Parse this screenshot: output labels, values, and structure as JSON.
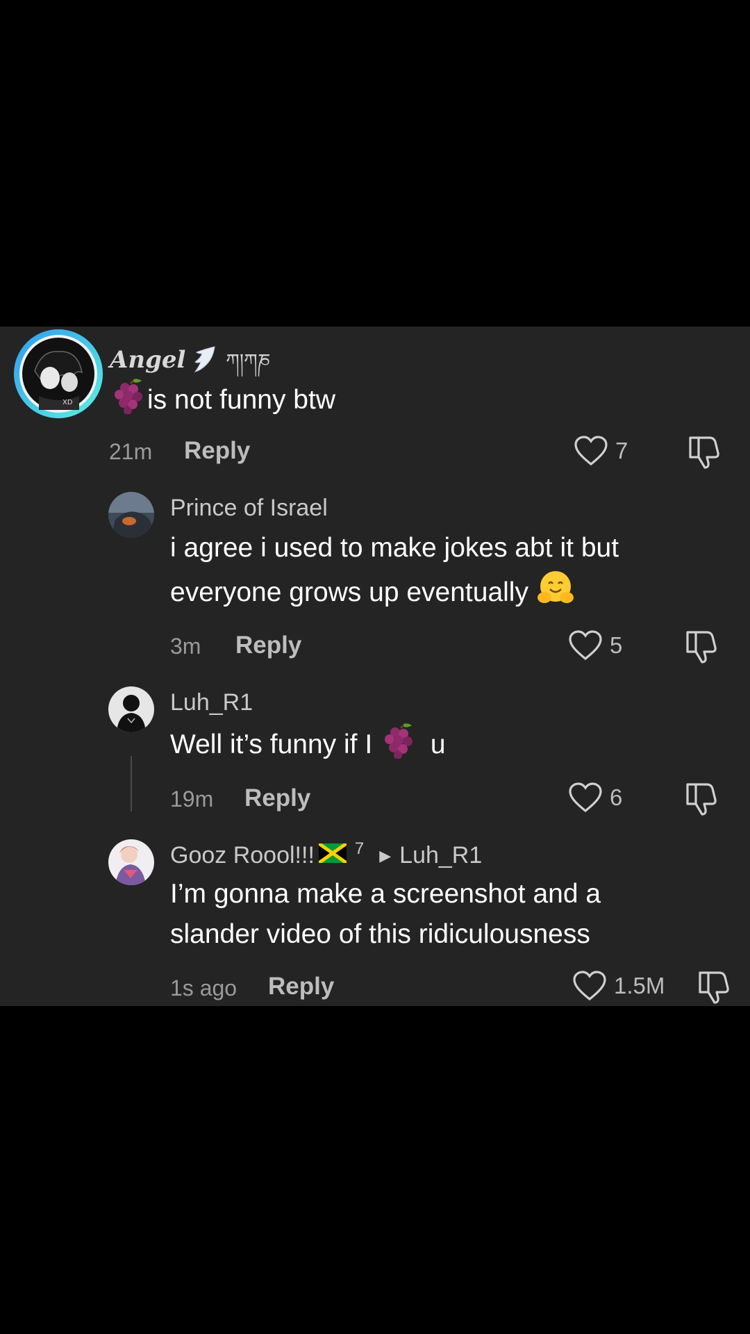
{
  "colors": {
    "background": "#000000",
    "panel": "#242424",
    "avatar_ring": "#3ec6ff",
    "text_primary": "#ffffff",
    "text_secondary": "#9a9a9a"
  },
  "comments": [
    {
      "author": "Angel",
      "author_suffix": "ཀ།ཀཎ",
      "author_badge_icon": "wing-icon",
      "text": "is not funny btw",
      "text_emoji": "grapes-emoji",
      "time": "21m",
      "reply_label": "Reply",
      "likes": "7"
    },
    {
      "author": "Prince of Israel",
      "text_line1": "i agree i used to make jokes abt it but",
      "text_line2": "everyone grows up eventually",
      "text_emoji": "hugging-face-emoji",
      "time": "3m",
      "reply_label": "Reply",
      "likes": "5"
    },
    {
      "author": "Luh_R1",
      "text_before": "Well it’s funny if I",
      "text_emoji": "grapes-emoji",
      "text_after": "u",
      "time": "19m",
      "reply_label": "Reply",
      "likes": "6"
    },
    {
      "author": "Gooz Roool!!!",
      "author_flag": "jamaica-flag-icon",
      "author_number": "7",
      "reply_to": "Luh_R1",
      "text_line1": "I’m gonna make a screenshot and a",
      "text_line2": "slander video of this ridiculousness",
      "time": "1s ago",
      "reply_label": "Reply",
      "likes": "1.5M"
    }
  ]
}
